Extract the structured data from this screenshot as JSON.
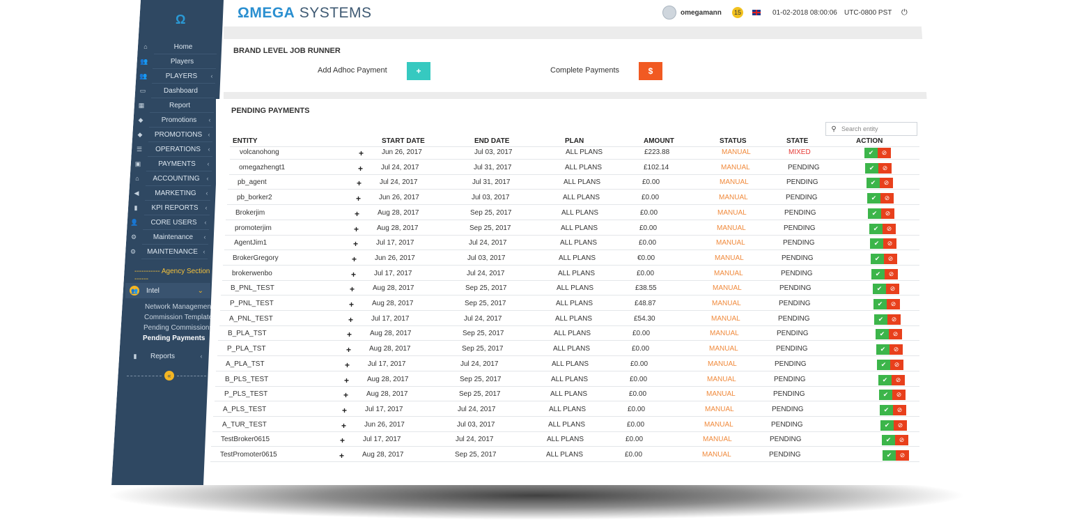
{
  "brand": {
    "accent": "ΩMEGA",
    "rest": "SYSTEMS",
    "logo_icon": "omega-logo-icon"
  },
  "topbar": {
    "username": "omegamann",
    "notifications": "15",
    "datetime": "01-02-2018 08:00:06",
    "timezone": "UTC-0800 PST",
    "power_icon": "⏻"
  },
  "sidebar": {
    "items": [
      {
        "label": "Home",
        "icon": "home-icon",
        "glyph": "⌂",
        "chevron": ""
      },
      {
        "label": "Players",
        "icon": "users-icon",
        "glyph": "👥",
        "chevron": ""
      },
      {
        "label": "PLAYERS",
        "icon": "users-icon",
        "glyph": "👥",
        "chevron": "‹"
      },
      {
        "label": "Dashboard",
        "icon": "monitor-icon",
        "glyph": "▭",
        "chevron": ""
      },
      {
        "label": "Report",
        "icon": "table-icon",
        "glyph": "▦",
        "chevron": ""
      },
      {
        "label": "Promotions",
        "icon": "tag-icon",
        "glyph": "◆",
        "chevron": "‹"
      },
      {
        "label": "PROMOTIONS",
        "icon": "tag-icon",
        "glyph": "◆",
        "chevron": "‹"
      },
      {
        "label": "OPERATIONS",
        "icon": "list-icon",
        "glyph": "☰",
        "chevron": "‹"
      },
      {
        "label": "PAYMENTS",
        "icon": "money-icon",
        "glyph": "▣",
        "chevron": "‹"
      },
      {
        "label": "ACCOUNTING",
        "icon": "bank-icon",
        "glyph": "⌂",
        "chevron": "‹"
      },
      {
        "label": "MARKETING",
        "icon": "bullhorn-icon",
        "glyph": "◀",
        "chevron": "‹"
      },
      {
        "label": "KPI REPORTS",
        "icon": "bar-chart-icon",
        "glyph": "▮",
        "chevron": "‹"
      },
      {
        "label": "CORE USERS",
        "icon": "user-plus-icon",
        "glyph": "👤",
        "chevron": "‹"
      },
      {
        "label": "Maintenance",
        "icon": "cogs-icon",
        "glyph": "⚙",
        "chevron": "‹"
      },
      {
        "label": "MAINTENANCE",
        "icon": "cogs-icon",
        "glyph": "⚙",
        "chevron": "‹"
      }
    ],
    "section_label": "----------- Agency Section -----------",
    "agency": {
      "label": "Intel",
      "chevron": "⌄",
      "badge_glyph": "👥"
    },
    "sub_items": [
      {
        "label": "Network Management",
        "active": false
      },
      {
        "label": "Commission Template",
        "active": false
      },
      {
        "label": "Pending Commissions",
        "active": false
      },
      {
        "label": "Pending Payments",
        "active": true
      }
    ],
    "reports": {
      "label": "Reports",
      "chevron": "‹"
    },
    "collapse_glyph": "«"
  },
  "job_runner": {
    "title": "BRAND LEVEL JOB RUNNER",
    "adhoc_label": "Add Adhoc Payment",
    "adhoc_button": "+",
    "complete_label": "Complete Payments",
    "complete_button": "$"
  },
  "pending": {
    "title": "PENDING PAYMENTS",
    "search_placeholder": "Search entity",
    "columns": [
      "ENTITY",
      "START DATE",
      "END DATE",
      "PLAN",
      "AMOUNT",
      "STATUS",
      "STATE",
      "ACTION"
    ],
    "rows": [
      [
        "volcanohong",
        "Jun 26, 2017",
        "Jul 03, 2017",
        "ALL PLANS",
        "£223.88",
        "MANUAL",
        "MIXED"
      ],
      [
        "omegazhengt1",
        "Jul 24, 2017",
        "Jul 31, 2017",
        "ALL PLANS",
        "£102.14",
        "MANUAL",
        "PENDING"
      ],
      [
        "pb_agent",
        "Jul 24, 2017",
        "Jul 31, 2017",
        "ALL PLANS",
        "£0.00",
        "MANUAL",
        "PENDING"
      ],
      [
        "pb_borker2",
        "Jun 26, 2017",
        "Jul 03, 2017",
        "ALL PLANS",
        "£0.00",
        "MANUAL",
        "PENDING"
      ],
      [
        "Brokerjim",
        "Aug 28, 2017",
        "Sep 25, 2017",
        "ALL PLANS",
        "£0.00",
        "MANUAL",
        "PENDING"
      ],
      [
        "promoterjim",
        "Aug 28, 2017",
        "Sep 25, 2017",
        "ALL PLANS",
        "£0.00",
        "MANUAL",
        "PENDING"
      ],
      [
        "AgentJim1",
        "Jul 17, 2017",
        "Jul 24, 2017",
        "ALL PLANS",
        "£0.00",
        "MANUAL",
        "PENDING"
      ],
      [
        "BrokerGregory",
        "Jun 26, 2017",
        "Jul 03, 2017",
        "ALL PLANS",
        "€0.00",
        "MANUAL",
        "PENDING"
      ],
      [
        "brokerwenbo",
        "Jul 17, 2017",
        "Jul 24, 2017",
        "ALL PLANS",
        "£0.00",
        "MANUAL",
        "PENDING"
      ],
      [
        "B_PNL_TEST",
        "Aug 28, 2017",
        "Sep 25, 2017",
        "ALL PLANS",
        "£38.55",
        "MANUAL",
        "PENDING"
      ],
      [
        "P_PNL_TEST",
        "Aug 28, 2017",
        "Sep 25, 2017",
        "ALL PLANS",
        "£48.87",
        "MANUAL",
        "PENDING"
      ],
      [
        "A_PNL_TEST",
        "Jul 17, 2017",
        "Jul 24, 2017",
        "ALL PLANS",
        "£54.30",
        "MANUAL",
        "PENDING"
      ],
      [
        "B_PLA_TST",
        "Aug 28, 2017",
        "Sep 25, 2017",
        "ALL PLANS",
        "£0.00",
        "MANUAL",
        "PENDING"
      ],
      [
        "P_PLA_TST",
        "Aug 28, 2017",
        "Sep 25, 2017",
        "ALL PLANS",
        "£0.00",
        "MANUAL",
        "PENDING"
      ],
      [
        "A_PLA_TST",
        "Jul 17, 2017",
        "Jul 24, 2017",
        "ALL PLANS",
        "£0.00",
        "MANUAL",
        "PENDING"
      ],
      [
        "B_PLS_TEST",
        "Aug 28, 2017",
        "Sep 25, 2017",
        "ALL PLANS",
        "£0.00",
        "MANUAL",
        "PENDING"
      ],
      [
        "P_PLS_TEST",
        "Aug 28, 2017",
        "Sep 25, 2017",
        "ALL PLANS",
        "£0.00",
        "MANUAL",
        "PENDING"
      ],
      [
        "A_PLS_TEST",
        "Jul 17, 2017",
        "Jul 24, 2017",
        "ALL PLANS",
        "£0.00",
        "MANUAL",
        "PENDING"
      ],
      [
        "A_TUR_TEST",
        "Jun 26, 2017",
        "Jul 03, 2017",
        "ALL PLANS",
        "£0.00",
        "MANUAL",
        "PENDING"
      ],
      [
        "TestBroker0615",
        "Jul 17, 2017",
        "Jul 24, 2017",
        "ALL PLANS",
        "£0.00",
        "MANUAL",
        "PENDING"
      ],
      [
        "TestPromoter0615",
        "Aug 28, 2017",
        "Sep 25, 2017",
        "ALL PLANS",
        "£0.00",
        "MANUAL",
        "PENDING"
      ]
    ],
    "row_plus": "+",
    "approve_glyph": "✔",
    "reject_glyph": "⊘"
  },
  "colors": {
    "sidebar": "#2f4862",
    "accent_blue": "#2a8fd0",
    "teal": "#36c9c0",
    "orange": "#f15a22",
    "manual": "#f08a3c",
    "mixed": "#e53935",
    "approve": "#3cb54a",
    "reject": "#e8401c"
  }
}
